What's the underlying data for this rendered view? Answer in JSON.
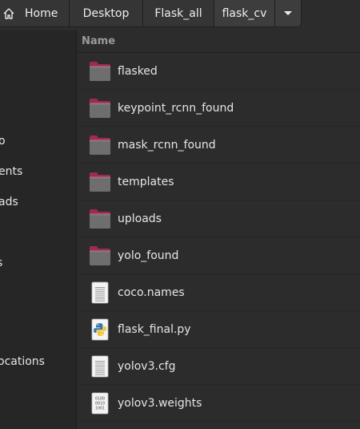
{
  "pathbar": {
    "crumbs": [
      "Home",
      "Desktop",
      "Flask_all",
      "flask_cv"
    ]
  },
  "sidebar": {
    "items": [
      "o",
      "ents",
      "ads",
      "s",
      "ocations"
    ]
  },
  "list": {
    "column_name": "Name",
    "files": [
      {
        "name": "flasked",
        "icon": "folder-icon"
      },
      {
        "name": "keypoint_rcnn_found",
        "icon": "folder-icon"
      },
      {
        "name": "mask_rcnn_found",
        "icon": "folder-icon"
      },
      {
        "name": "templates",
        "icon": "folder-icon"
      },
      {
        "name": "uploads",
        "icon": "folder-icon"
      },
      {
        "name": "yolo_found",
        "icon": "folder-icon"
      },
      {
        "name": "coco.names",
        "icon": "text-file-icon"
      },
      {
        "name": "flask_final.py",
        "icon": "python-file-icon"
      },
      {
        "name": "yolov3.cfg",
        "icon": "text-file-icon"
      },
      {
        "name": "yolov3.weights",
        "icon": "binary-file-icon"
      }
    ]
  },
  "colors": {
    "folder_body": "#6e6e6e",
    "folder_tab": "#9c2b55",
    "background": "#2c2c2c",
    "sidebar": "#262626"
  }
}
